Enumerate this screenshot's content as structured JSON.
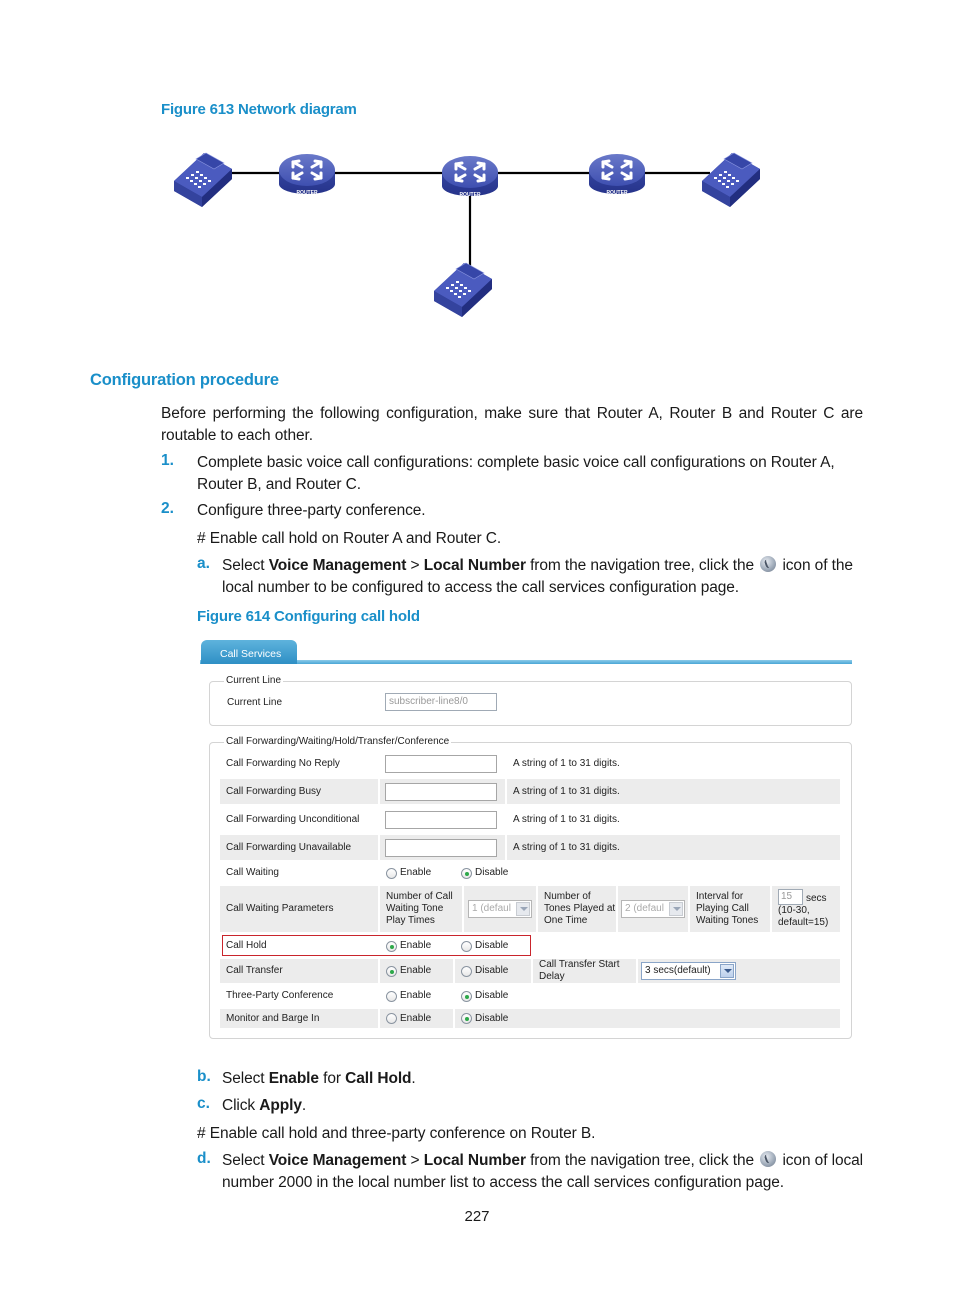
{
  "figure613": {
    "caption": "Figure 613 Network diagram",
    "nodes": [
      {
        "type": "phone-icon"
      },
      {
        "type": "router-icon",
        "label": "ROUTER"
      },
      {
        "type": "router-icon",
        "label": "ROUTER"
      },
      {
        "type": "router-icon",
        "label": "ROUTER"
      },
      {
        "type": "phone-icon"
      },
      {
        "type": "phone-icon"
      }
    ]
  },
  "section": {
    "title": "Configuration procedure",
    "intro": "Before performing the following configuration, make sure that Router A, Router B and Router C are routable to each other.",
    "steps": [
      {
        "num": "1.",
        "text": "Complete basic voice call configurations: complete basic voice call configurations on Router A, Router B, and Router C."
      },
      {
        "num": "2.",
        "text": "Configure three-party conference."
      }
    ],
    "comment1": "# Enable call hold on Router A and Router C.",
    "substep_a": {
      "letter": "a.",
      "pre": "Select ",
      "bold1": "Voice Management",
      "sep": " > ",
      "bold2": "Local Number",
      "mid": " from the navigation tree, click the ",
      "post": " icon of the local number to be configured to access the call services configuration page."
    },
    "substep_b": {
      "letter": "b.",
      "pre": "Select ",
      "bold1": "Enable",
      "mid": " for ",
      "bold2": "Call Hold",
      "post": "."
    },
    "substep_c": {
      "letter": "c.",
      "pre": "Click ",
      "bold1": "Apply",
      "post": "."
    },
    "comment2": "# Enable call hold and three-party conference on Router B.",
    "substep_d": {
      "letter": "d.",
      "pre": "Select ",
      "bold1": "Voice Management",
      "sep": " > ",
      "bold2": "Local Number",
      "mid": " from the navigation tree, click the ",
      "post": " icon of local number 2000 in the local number list to access the call services configuration page."
    }
  },
  "figure614": {
    "caption": "Figure 614 Configuring call hold",
    "tab": "Call Services",
    "current_line": {
      "legend": "Current Line",
      "label": "Current Line",
      "value": "subscriber-line8/0"
    },
    "services": {
      "legend": "Call Forwarding/Waiting/Hold/Transfer/Conference",
      "forwarding": [
        {
          "label": "Call Forwarding No Reply",
          "value": "",
          "hint": "A string of 1 to 31 digits."
        },
        {
          "label": "Call Forwarding Busy",
          "value": "",
          "hint": "A string of 1 to 31 digits."
        },
        {
          "label": "Call Forwarding Unconditional",
          "value": "",
          "hint": "A string of 1 to 31 digits."
        },
        {
          "label": "Call Forwarding Unavailable",
          "value": "",
          "hint": "A string of 1 to 31 digits."
        }
      ],
      "enable_label": "Enable",
      "disable_label": "Disable",
      "call_waiting": {
        "label": "Call Waiting",
        "selected": "Disable"
      },
      "call_waiting_params": {
        "label": "Call Waiting Parameters",
        "tone_times_label": "Number of Call Waiting Tone Play Times",
        "tone_times_value": "1 (defaul",
        "tones_per_time_label": "Number of Tones Played at One Time",
        "tones_per_time_value": "2 (defaul",
        "interval_label": "Interval for Playing Call Waiting Tones",
        "interval_value": "15",
        "interval_unit": "secs",
        "interval_hint": "(10-30, default=15)"
      },
      "call_hold": {
        "label": "Call Hold",
        "selected": "Enable"
      },
      "call_transfer": {
        "label": "Call Transfer",
        "selected": "Enable",
        "delay_label": "Call Transfer Start Delay",
        "delay_value": "3 secs(default)"
      },
      "three_party": {
        "label": "Three-Party Conference",
        "selected": "Disable"
      },
      "monitor_barge": {
        "label": "Monitor and Barge In",
        "selected": "Disable"
      }
    },
    "colors": {
      "accent": "#1a8fc9",
      "highlight": "#c9252c",
      "tab": "#2e8fc5"
    }
  },
  "page_number": "227"
}
